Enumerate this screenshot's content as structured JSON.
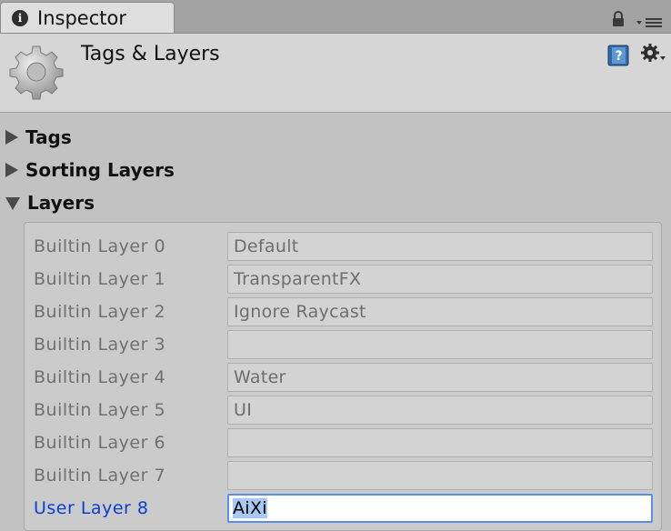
{
  "tab": {
    "label": "Inspector",
    "icon": "info-icon"
  },
  "header": {
    "title": "Tags & Layers"
  },
  "sections": [
    {
      "label": "Tags",
      "expanded": false
    },
    {
      "label": "Sorting Layers",
      "expanded": false
    },
    {
      "label": "Layers",
      "expanded": true
    }
  ],
  "layers": [
    {
      "label": "Builtin Layer 0",
      "value": "Default"
    },
    {
      "label": "Builtin Layer 1",
      "value": "TransparentFX"
    },
    {
      "label": "Builtin Layer 2",
      "value": "Ignore Raycast"
    },
    {
      "label": "Builtin Layer 3",
      "value": ""
    },
    {
      "label": "Builtin Layer 4",
      "value": "Water"
    },
    {
      "label": "Builtin Layer 5",
      "value": "UI"
    },
    {
      "label": "Builtin Layer 6",
      "value": ""
    },
    {
      "label": "Builtin Layer 7",
      "value": ""
    },
    {
      "label": "User Layer 8",
      "value": "AiXi"
    }
  ],
  "colors": {
    "user_label": "#0a3fd6",
    "builtin_label": "#707070",
    "selection": "#a7c8f3",
    "focus_border": "#5a8ee8"
  }
}
